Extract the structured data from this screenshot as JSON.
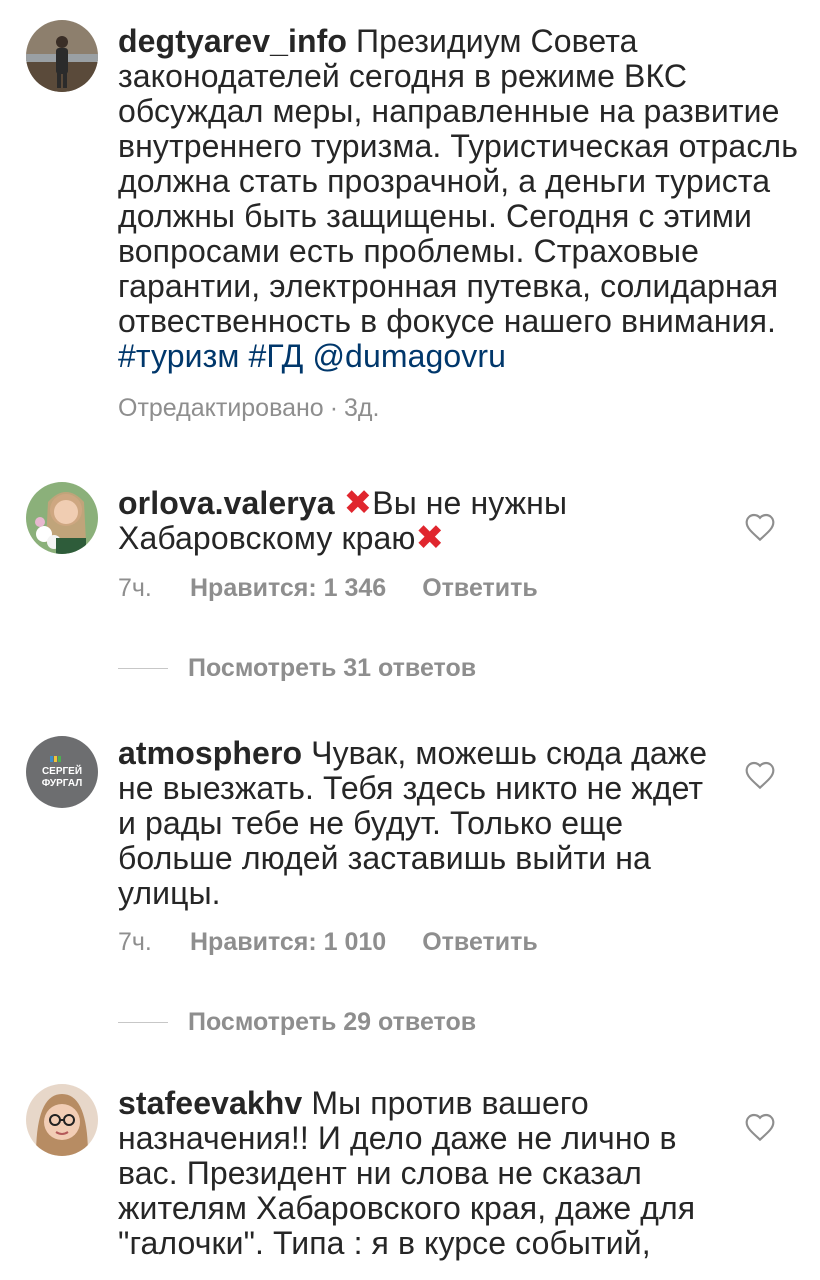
{
  "post": {
    "username": "degtyarev_info",
    "caption": "Президиум Совета законодателей сегодня в режиме ВКС обсуждал меры, направленные на развитие внутреннего туризма. Туристическая отрасль должна стать прозрачной, а деньги туриста должны быть защищены. Сегодня с этими вопросами есть проблемы. Страховые гарантии, электронная путевка, солидарная отвественность в фокусе нашего внимания.",
    "tags": [
      "#туризм",
      "#ГД",
      "@dumagovru"
    ],
    "edited_label": "Отредактировано",
    "time": "3д."
  },
  "comments": [
    {
      "username": "orlova.valerya",
      "text_a": "Вы не нужны Хабаровскому краю",
      "time": "7ч.",
      "likes": "Нравится: 1 346",
      "reply_label": "Ответить",
      "view_replies": "Посмотреть 31 ответов"
    },
    {
      "username": "atmosphero",
      "avatar_text_1": "СЕРГЕЙ",
      "avatar_text_2": "ФУРГАЛ",
      "text": "Чувак, можешь сюда даже не выезжать. Тебя здесь никто не ждет и рады тебе не будут. Только еще больше людей заставишь выйти на улицы.",
      "time": "7ч.",
      "likes": "Нравится: 1 010",
      "reply_label": "Ответить",
      "view_replies": "Посмотреть 29 ответов"
    },
    {
      "username": "stafeevakhv",
      "text": "Мы против вашего назначения!! И дело даже не лично в вас. Президент ни слова не сказал жителям Хабаровского края, даже для \"галочки\". Типа : я в курсе событий,"
    }
  ],
  "icons": {
    "heart": "heart-outline-icon",
    "red_x": "cross-mark-emoji"
  },
  "colors": {
    "text": "#262626",
    "meta": "#8e8e8e",
    "link": "#00376b",
    "red_x": "#e0262e"
  }
}
